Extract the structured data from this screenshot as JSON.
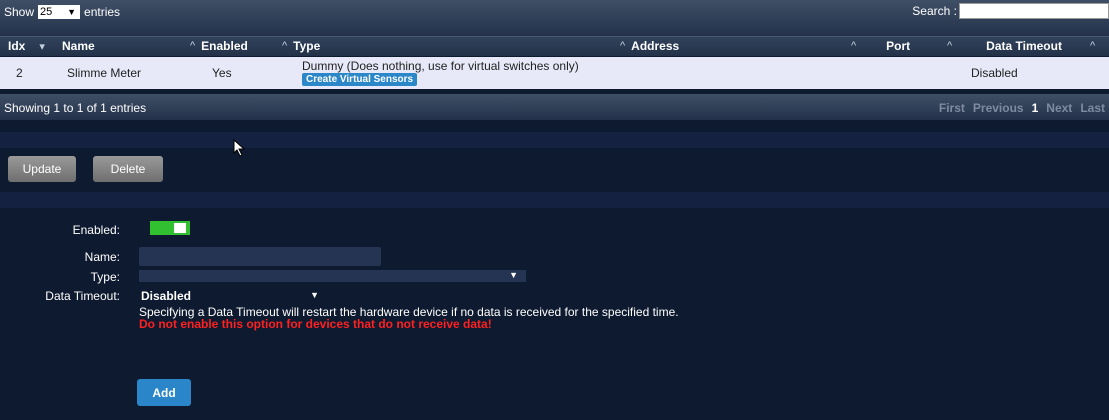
{
  "table_controls": {
    "show_label": "Show",
    "length_value": "25",
    "entries_label": "entries",
    "search_label": "Search :",
    "search_value": ""
  },
  "columns": [
    {
      "label": "Idx",
      "sort": "▾"
    },
    {
      "label": "Name",
      "sort": "^"
    },
    {
      "label": "Enabled",
      "sort": "^"
    },
    {
      "label": "Type",
      "sort": "^"
    },
    {
      "label": "Address",
      "sort": "^"
    },
    {
      "label": "Port",
      "sort": "^"
    },
    {
      "label": "Data Timeout",
      "sort": "^"
    }
  ],
  "rows": [
    {
      "idx": "2",
      "name": "Slimme Meter",
      "enabled": "Yes",
      "type": "Dummy (Does nothing, use for virtual switches only)",
      "type_button": "Create Virtual Sensors",
      "address": "",
      "port": "",
      "data_timeout": "Disabled"
    }
  ],
  "footer": {
    "info": "Showing 1 to 1 of 1 entries",
    "pages": [
      "First",
      "Previous",
      "1",
      "Next",
      "Last"
    ]
  },
  "actions": {
    "update": "Update",
    "delete": "Delete"
  },
  "form": {
    "enabled_label": "Enabled:",
    "enabled_state": true,
    "name_label": "Name:",
    "name_value": "",
    "type_label": "Type:",
    "type_value": "",
    "data_timeout_label": "Data Timeout:",
    "data_timeout_value": "Disabled",
    "hint": "Specifying a Data Timeout will restart the hardware device if no data is received for the specified time.",
    "warning": "Do not enable this option for devices that do not receive data!",
    "add": "Add"
  },
  "colors": {
    "background": "#0e1a30",
    "row_bg": "#e7e9f8",
    "accent_blue": "#2a86c8",
    "toggle_on": "#30c030",
    "warning": "#ff2020"
  }
}
